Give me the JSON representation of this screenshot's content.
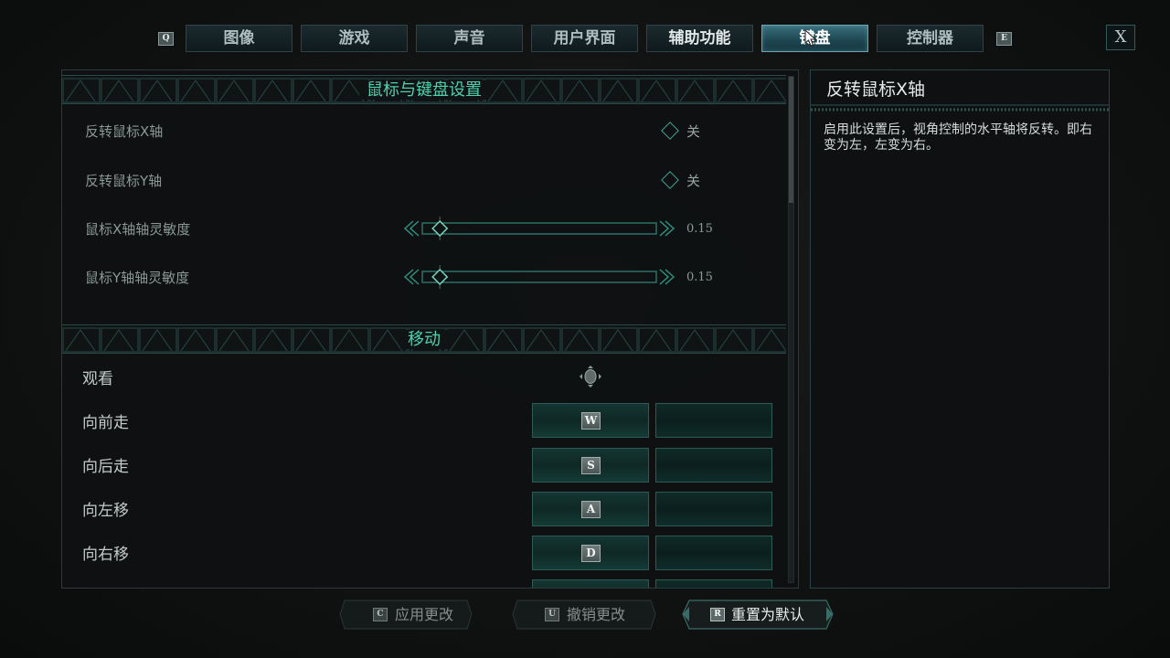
{
  "tabs": {
    "prev_key": "Q",
    "next_key": "E",
    "items": [
      {
        "label": "图像"
      },
      {
        "label": "游戏"
      },
      {
        "label": "声音"
      },
      {
        "label": "用户界面"
      },
      {
        "label": "辅助功能"
      },
      {
        "label": "键盘"
      },
      {
        "label": "控制器"
      }
    ],
    "active_index": 5,
    "close_label": "X"
  },
  "mouse_keyboard_section": {
    "title": "鼠标与键盘设置",
    "settings": [
      {
        "label": "反转鼠标X轴",
        "type": "toggle",
        "value": "关"
      },
      {
        "label": "反转鼠标Y轴",
        "type": "toggle",
        "value": "关"
      },
      {
        "label": "鼠标X轴轴灵敏度",
        "type": "slider",
        "value": "0.15",
        "fraction": 0.15
      },
      {
        "label": "鼠标Y轴轴灵敏度",
        "type": "slider",
        "value": "0.15",
        "fraction": 0.15
      }
    ]
  },
  "movement_section": {
    "title": "移动",
    "look_label": "观看",
    "look_icon": "mouse-move-icon",
    "bindings": [
      {
        "label": "向前走",
        "primary": "W",
        "secondary": ""
      },
      {
        "label": "向后走",
        "primary": "S",
        "secondary": ""
      },
      {
        "label": "向左移",
        "primary": "A",
        "secondary": ""
      },
      {
        "label": "向右移",
        "primary": "D",
        "secondary": ""
      }
    ]
  },
  "info": {
    "title": "反转鼠标X轴",
    "description": "启用此设置后，视角控制的水平轴将反转。即右变为左，左变为右。"
  },
  "footer": {
    "apply": {
      "key": "C",
      "label": "应用更改"
    },
    "revert": {
      "key": "U",
      "label": "撤销更改"
    },
    "reset": {
      "key": "R",
      "label": "重置为默认"
    }
  },
  "colors": {
    "accent": "#4fd0ac",
    "active_tab": "#2b5b66",
    "border": "#2a4a48"
  }
}
